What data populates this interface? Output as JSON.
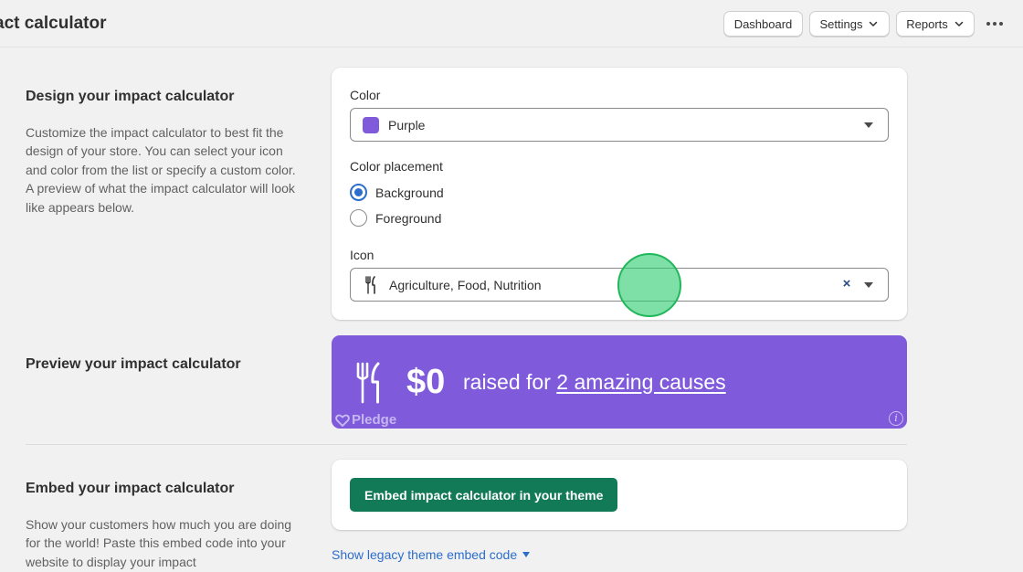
{
  "header": {
    "title": "act calculator",
    "dashboard_label": "Dashboard",
    "settings_label": "Settings",
    "reports_label": "Reports"
  },
  "design": {
    "title": "Design your impact calculator",
    "description": "Customize the impact calculator to best fit the design of your store. You can select your icon and color from the list or specify a custom color. A preview of what the impact calculator will look like appears below.",
    "color_label": "Color",
    "color_value": "Purple",
    "color_swatch": "#7f5bdc",
    "placement_label": "Color placement",
    "placement_options": [
      {
        "label": "Background",
        "selected": true
      },
      {
        "label": "Foreground",
        "selected": false
      }
    ],
    "icon_label": "Icon",
    "icon_value": "Agriculture, Food, Nutrition",
    "icon_name": "fork-knife-icon"
  },
  "preview": {
    "title": "Preview your impact calculator",
    "amount": "$0",
    "raised_prefix": "raised for ",
    "causes_link": "2 amazing causes",
    "brand": "Pledge",
    "background_color": "#7f5bdc"
  },
  "embed": {
    "title": "Embed your impact calculator",
    "description": "Show your customers how much you are doing for the world! Paste this embed code into your website to display your impact",
    "button_label": "Embed impact calculator in your theme",
    "button_color": "#127a57",
    "legacy_link": "Show legacy theme embed code"
  }
}
